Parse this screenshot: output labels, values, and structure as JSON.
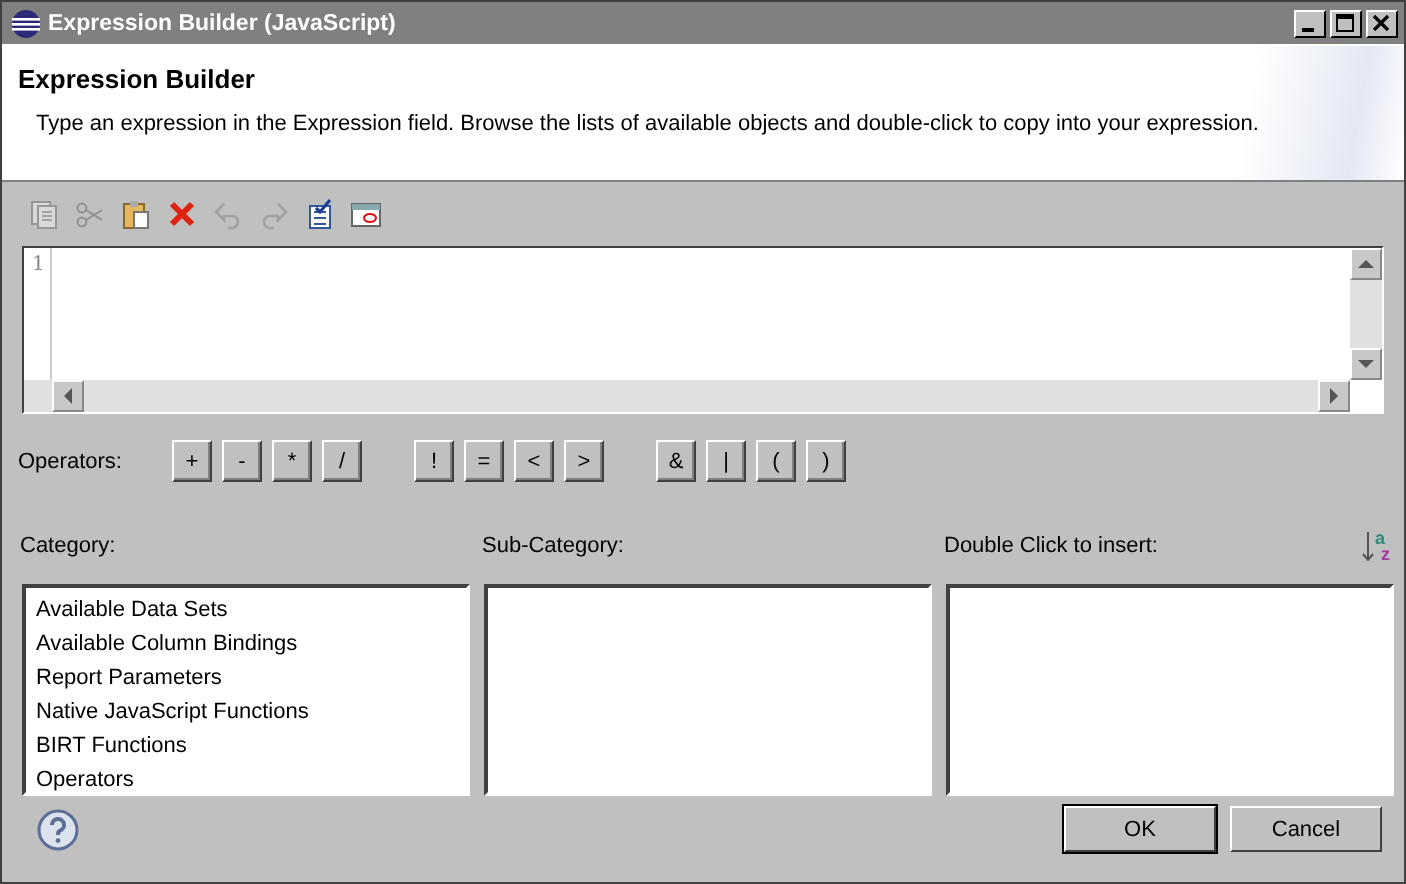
{
  "window": {
    "title": "Expression Builder (JavaScript)"
  },
  "header": {
    "title": "Expression Builder",
    "description": "Type an expression in the Expression field. Browse the lists of available objects and double-click to copy into your expression."
  },
  "toolbar": [
    {
      "kind": "copy",
      "disabled": true
    },
    {
      "kind": "cut",
      "disabled": true
    },
    {
      "kind": "paste",
      "disabled": false
    },
    {
      "kind": "delete",
      "disabled": false
    },
    {
      "kind": "undo",
      "disabled": true
    },
    {
      "kind": "redo",
      "disabled": true
    },
    {
      "kind": "validate",
      "disabled": false
    },
    {
      "kind": "calendar",
      "disabled": false
    }
  ],
  "editor": {
    "line_numbers": [
      "1"
    ]
  },
  "operators": {
    "label": "Operators:",
    "groups": [
      [
        "+",
        "-",
        "*",
        "/"
      ],
      [
        "!",
        "=",
        "<",
        ">"
      ],
      [
        "&",
        "|",
        "(",
        ")"
      ]
    ]
  },
  "panes": [
    {
      "label": "Category:",
      "items": [
        "Available Data Sets",
        "Available Column Bindings",
        "Report Parameters",
        "Native JavaScript Functions",
        "BIRT Functions",
        "Operators"
      ]
    },
    {
      "label": "Sub-Category:"
    },
    {
      "label": "Double Click to insert:",
      "sort_icon": {
        "letters": [
          "a",
          "z"
        ]
      }
    }
  ],
  "buttons": [
    "OK",
    "Cancel"
  ]
}
